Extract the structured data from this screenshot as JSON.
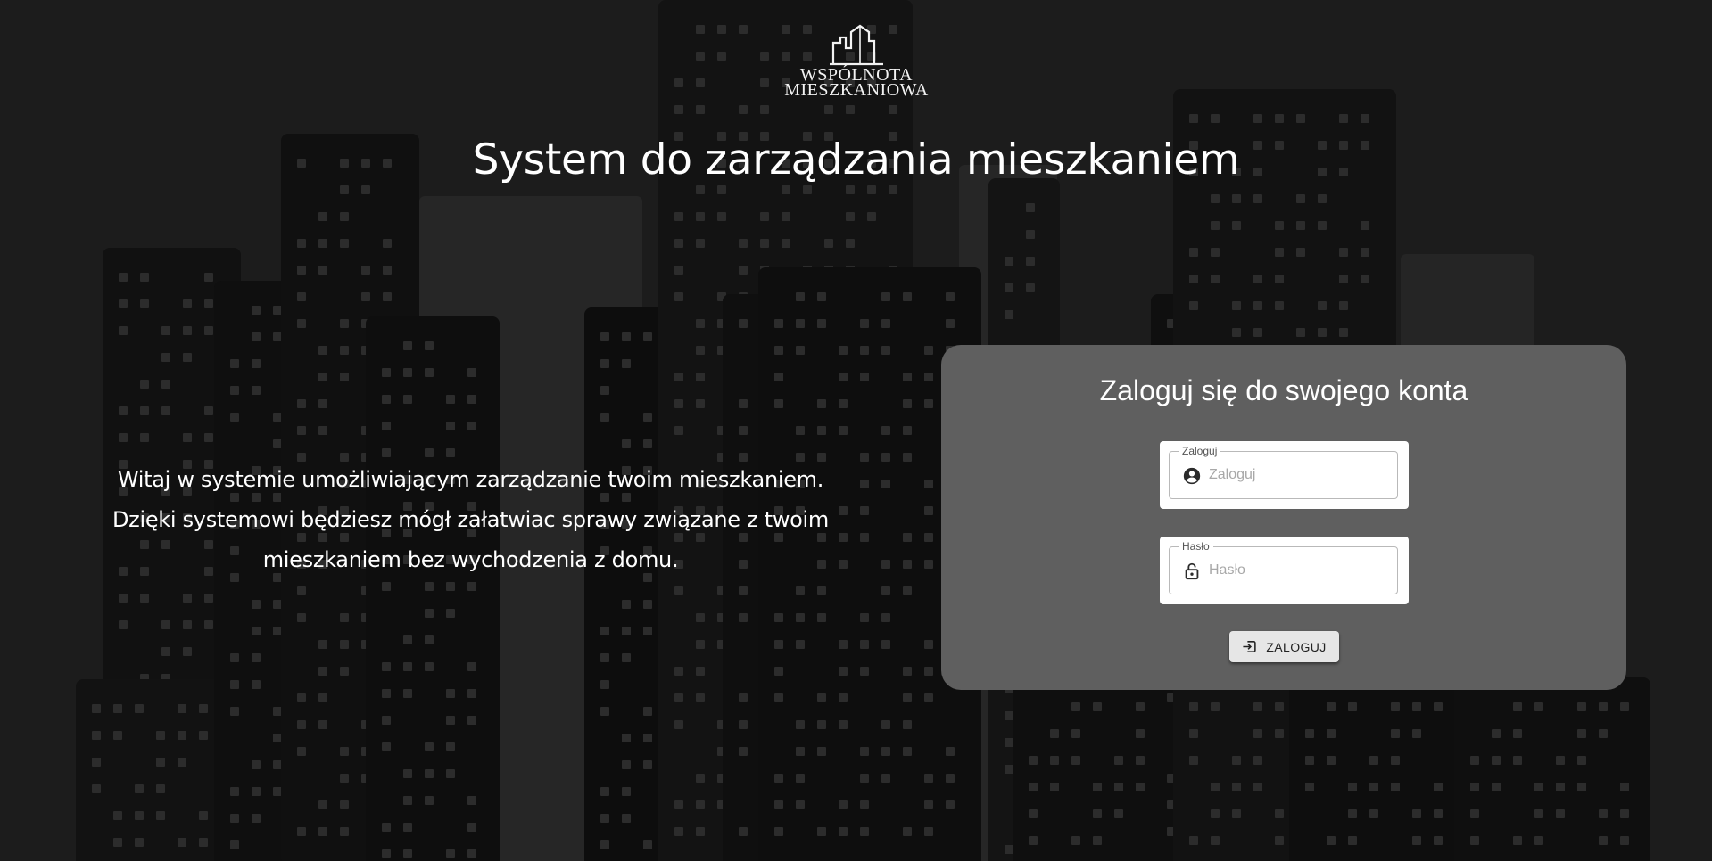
{
  "logo": {
    "line1": "Wspólnota",
    "line2": "Mieszkaniowa"
  },
  "page_title": "System do zarządzania mieszkaniem",
  "welcome": {
    "line1": "Witaj w systemie umożliwiającym zarządzanie twoim mieszkaniem.",
    "line2": "Dzięki systemowi będziesz mógł załatwiac sprawy związane z twoim",
    "line3": "mieszkaniem bez wychodzenia z domu."
  },
  "login": {
    "title": "Zaloguj się do swojego konta",
    "username": {
      "label": "Zaloguj",
      "placeholder": "Zaloguj",
      "value": "",
      "icon": "account-circle-icon"
    },
    "password": {
      "label": "Hasło",
      "placeholder": "Hasło",
      "value": "",
      "icon": "lock-open-icon"
    },
    "button": {
      "label": "ZALOGUJ",
      "icon": "login-icon"
    }
  },
  "colors": {
    "background": "#1c1c1c",
    "card": "#5f5f5f",
    "button": "#e6e6e6"
  }
}
